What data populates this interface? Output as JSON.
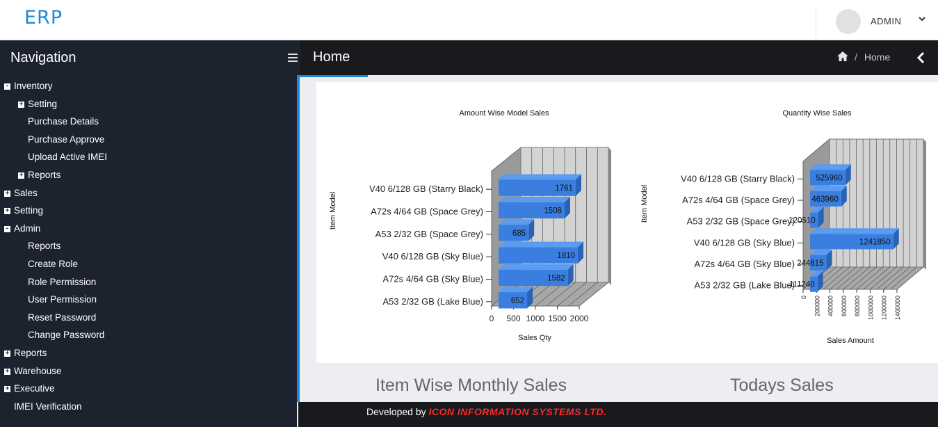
{
  "app": {
    "brand": "ERP"
  },
  "user": {
    "name": "ADMIN"
  },
  "nav": {
    "title": "Navigation",
    "items": [
      {
        "label": "Inventory",
        "level": 0,
        "toggle": "-"
      },
      {
        "label": "Setting",
        "level": 1,
        "toggle": "+"
      },
      {
        "label": "Purchase Details",
        "level": 1,
        "toggle": ""
      },
      {
        "label": "Purchase Approve",
        "level": 1,
        "toggle": ""
      },
      {
        "label": "Upload Active IMEI",
        "level": 1,
        "toggle": ""
      },
      {
        "label": "Reports",
        "level": 1,
        "toggle": "+"
      },
      {
        "label": "Sales",
        "level": 0,
        "toggle": "+"
      },
      {
        "label": "Setting",
        "level": 0,
        "toggle": "+"
      },
      {
        "label": "Admin",
        "level": 0,
        "toggle": "-"
      },
      {
        "label": "Reports",
        "level": 1,
        "toggle": ""
      },
      {
        "label": "Create Role",
        "level": 1,
        "toggle": ""
      },
      {
        "label": "Role Permission",
        "level": 1,
        "toggle": ""
      },
      {
        "label": "User Permission",
        "level": 1,
        "toggle": ""
      },
      {
        "label": "Reset Password",
        "level": 1,
        "toggle": ""
      },
      {
        "label": "Change Password",
        "level": 1,
        "toggle": ""
      },
      {
        "label": "Reports",
        "level": 0,
        "toggle": "+"
      },
      {
        "label": "Warehouse",
        "level": 0,
        "toggle": "+"
      },
      {
        "label": "Executive",
        "level": 0,
        "toggle": "+"
      },
      {
        "label": "IMEI Verification",
        "level": 0,
        "toggle": ""
      }
    ]
  },
  "header": {
    "title": "Home",
    "breadcrumb_sep": "/",
    "breadcrumb_current": "Home"
  },
  "sections": {
    "monthly": "Item Wise Monthly Sales",
    "today": "Todays Sales"
  },
  "footer": {
    "prefix": "Developed by",
    "company": "ICON INFORMATION SYSTEMS LTD."
  },
  "colors": {
    "accent": "#1e88d6",
    "bar": "#3a7fe0",
    "footer_brand": "#ff2a2a"
  },
  "chart_data": [
    {
      "type": "bar",
      "orientation": "horizontal",
      "title": "Amount Wise Model Sales",
      "xlabel": "Sales Qty",
      "ylabel": "Item Model",
      "categories": [
        "V40 6/128 GB (Starry Black)",
        "A72s 4/64 GB (Space Grey)",
        "A53 2/32 GB (Space Grey)",
        "V40 6/128 GB (Sky Blue)",
        "A72s 4/64 GB (Sky Blue)",
        "A53 2/32 GB (Lake Blue)"
      ],
      "values": [
        1761,
        1508,
        685,
        1810,
        1582,
        652
      ],
      "xlim": [
        0,
        2000
      ],
      "ticks": [
        "0",
        "500",
        "1000",
        "1500",
        "2000"
      ]
    },
    {
      "type": "bar",
      "orientation": "horizontal",
      "title": "Quantity Wise Sales",
      "xlabel": "Sales Amount",
      "ylabel": "Item Model",
      "categories": [
        "V40 6/128 GB (Starry Black)",
        "A72s 4/64 GB (Space Grey)",
        "A53 2/32 GB (Space Grey)",
        "V40 6/128 GB (Sky Blue)",
        "A72s 4/64 GB (Sky Blue)",
        "A53 2/32 GB (Lake Blue)"
      ],
      "values": [
        525960,
        463960,
        120510,
        1241850,
        244815,
        111240
      ],
      "xlim": [
        0,
        1400000
      ],
      "ticks": [
        "0",
        "200000",
        "400000",
        "600000",
        "800000",
        "1000000",
        "1200000",
        "1400000"
      ]
    }
  ]
}
